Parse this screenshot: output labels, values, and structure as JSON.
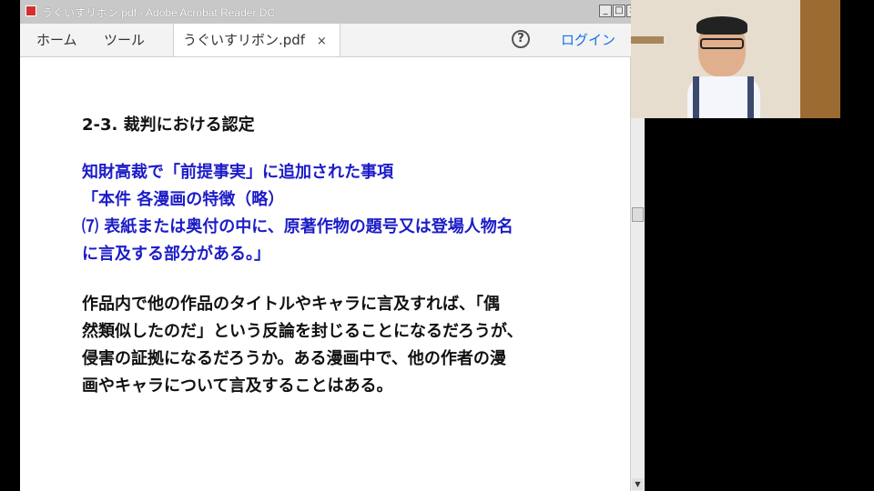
{
  "window": {
    "title": "うぐいすリボン.pdf - Adobe Acrobat Reader DC",
    "controls": {
      "minimize": "_",
      "maximize": "□",
      "close": "×"
    }
  },
  "tabs": {
    "home": "ホーム",
    "tools": "ツール",
    "document": "うぐいすリボン.pdf",
    "close_glyph": "×",
    "help": "?",
    "login": "ログイン"
  },
  "document": {
    "heading": "2-3.  裁判における認定",
    "blue_lines": [
      "知財高裁で「前提事実」に追加された事項",
      "「本件  各漫画の特徴（略）",
      "⑺  表紙または奥付の中に、原著作物の題号又は登場人物名",
      "に言及する部分がある。」"
    ],
    "body_lines": [
      "作品内で他の作品のタイトルやキャラに言及すれば、「偶",
      "然類似したのだ」という反論を封じることになるだろうが、",
      "侵害の証拠になるだろうか。ある漫画中で、他の作者の漫",
      "画やキャラについて言及することはある。"
    ]
  },
  "colors": {
    "accent_blue_text": "#1c1cc8",
    "login_link": "#1473e6"
  },
  "icons": [
    "acrobat-app-icon",
    "help-icon",
    "close-icon",
    "scroll-up-icon",
    "scroll-down-icon"
  ]
}
